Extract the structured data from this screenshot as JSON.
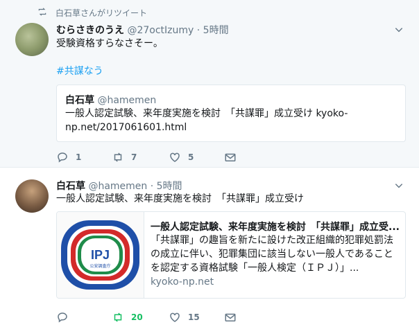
{
  "tweets": [
    {
      "retweet_notice": "白石草さんがリツイート",
      "name": "むらさきのうえ",
      "handle": "@27octIzumy",
      "sep": " · ",
      "time": "5時間",
      "text": "受験資格すらなさそー。",
      "hashtag": "#共謀なう",
      "quote": {
        "name": "白石草",
        "handle": "@hamemen",
        "text": "一般人認定試験、来年度実施を検討　「共謀罪」成立受け kyoko-np.net/2017061601.html"
      },
      "actions": {
        "reply_count": "1",
        "retweet_count": "7",
        "like_count": "5"
      }
    },
    {
      "name": "白石草",
      "handle": "@hamemen",
      "sep": " · ",
      "time": "5時間",
      "text": "一般人認定試験、来年度実施を検討　「共謀罪」成立受け",
      "card": {
        "logo_text": "IPJ",
        "logo_subtext": "公安調査庁",
        "title": "一般人認定試験、来年度実施を検討　「共謀罪」成立受...",
        "description": "「共謀罪」の趣旨を新たに設けた改正組織的犯罪処罰法の成立に伴い、犯罪集団に該当しない一般人であることを認定する資格試験「一般人検定（ＩＰＪ）」...",
        "url": "kyoko-np.net"
      },
      "actions": {
        "reply_count": "",
        "retweet_count": "20",
        "like_count": "15"
      }
    }
  ],
  "colors": {
    "accent": "#1da1f2",
    "retweeted": "#17bf63",
    "muted": "#657786"
  }
}
